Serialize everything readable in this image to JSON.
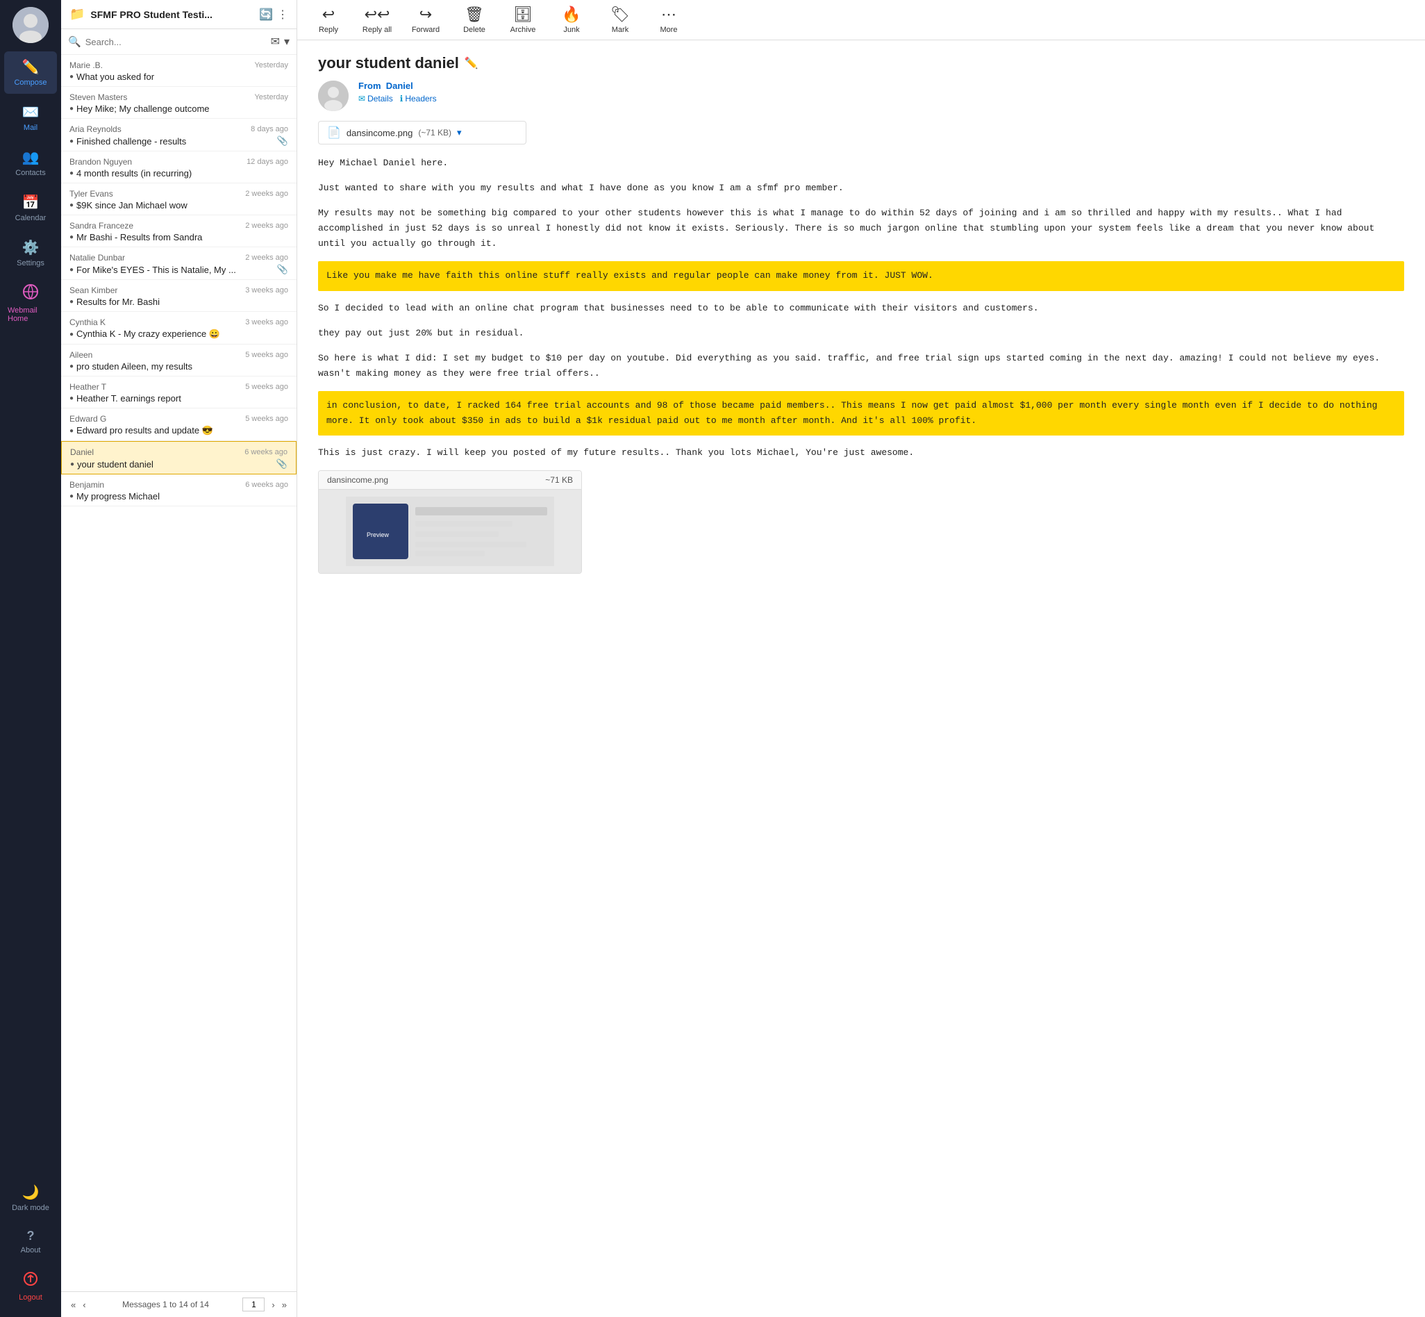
{
  "sidebar": {
    "nav_items": [
      {
        "id": "compose",
        "label": "Compose",
        "icon": "✏️",
        "active": false,
        "class": "compose"
      },
      {
        "id": "mail",
        "label": "Mail",
        "icon": "✉️",
        "active": true
      },
      {
        "id": "contacts",
        "label": "Contacts",
        "icon": "👥",
        "active": false
      },
      {
        "id": "calendar",
        "label": "Calendar",
        "icon": "📅",
        "active": false
      },
      {
        "id": "settings",
        "label": "Settings",
        "icon": "⚙️",
        "active": false
      },
      {
        "id": "webmail",
        "label": "Webmail Home",
        "icon": "🔗",
        "active": false
      }
    ],
    "bottom_items": [
      {
        "id": "dark-mode",
        "label": "Dark mode",
        "icon": "🌙"
      },
      {
        "id": "about",
        "label": "About",
        "icon": "?"
      },
      {
        "id": "logout",
        "label": "Logout",
        "icon": "⏻",
        "class": "logout"
      }
    ]
  },
  "panel": {
    "title": "SFMF PRO Student Testi...",
    "search_placeholder": "Search..."
  },
  "toolbar": {
    "reply_label": "Reply",
    "reply_all_label": "Reply all",
    "forward_label": "Forward",
    "delete_label": "Delete",
    "archive_label": "Archive",
    "junk_label": "Junk",
    "mark_label": "Mark",
    "more_label": "More"
  },
  "emails": [
    {
      "sender": "Marie .B.",
      "date": "Yesterday",
      "subject": "What you asked for",
      "has_attach": false,
      "bullet": true
    },
    {
      "sender": "Steven Masters",
      "date": "Yesterday",
      "subject": "Hey Mike; My challenge outcome",
      "has_attach": false,
      "bullet": true
    },
    {
      "sender": "Aria Reynolds",
      "date": "8 days ago",
      "subject": "Finished challenge - results",
      "has_attach": true,
      "bullet": true
    },
    {
      "sender": "Brandon Nguyen",
      "date": "12 days ago",
      "subject": "4 month results (in recurring)",
      "has_attach": false,
      "bullet": true
    },
    {
      "sender": "Tyler Evans",
      "date": "2 weeks ago",
      "subject": "$9K since Jan Michael wow",
      "has_attach": false,
      "bullet": true
    },
    {
      "sender": "Sandra Franceze",
      "date": "2 weeks ago",
      "subject": "Mr Bashi - Results from Sandra",
      "has_attach": false,
      "bullet": true
    },
    {
      "sender": "Natalie Dunbar",
      "date": "2 weeks ago",
      "subject": "For Mike's EYES - This is Natalie, My ...",
      "has_attach": true,
      "bullet": true
    },
    {
      "sender": "Sean Kimber",
      "date": "3 weeks ago",
      "subject": "Results for Mr. Bashi",
      "has_attach": false,
      "bullet": true
    },
    {
      "sender": "Cynthia K",
      "date": "3 weeks ago",
      "subject": "Cynthia K - My crazy experience 😀",
      "has_attach": false,
      "bullet": true
    },
    {
      "sender": "Aileen",
      "date": "5 weeks ago",
      "subject": "pro studen Aileen, my results",
      "has_attach": false,
      "bullet": true
    },
    {
      "sender": "Heather T",
      "date": "5 weeks ago",
      "subject": "Heather T. earnings report",
      "has_attach": false,
      "bullet": true
    },
    {
      "sender": "Edward G",
      "date": "5 weeks ago",
      "subject": "Edward pro results and update 😎",
      "has_attach": false,
      "bullet": true
    },
    {
      "sender": "Daniel",
      "date": "6 weeks ago",
      "subject": "your student daniel",
      "has_attach": true,
      "bullet": true,
      "selected": true
    },
    {
      "sender": "Benjamin",
      "date": "6 weeks ago",
      "subject": "My progress Michael",
      "has_attach": false,
      "bullet": true
    }
  ],
  "list_footer": {
    "info": "Messages 1 to 14 of 14",
    "page": "1"
  },
  "email_view": {
    "subject": "your student daniel",
    "from_label": "From",
    "from_name": "Daniel",
    "details_label": "Details",
    "headers_label": "Headers",
    "attachment_name": "dansincome.png",
    "attachment_size": "(~71 KB)",
    "body_lines": [
      "Hey Michael Daniel here.",
      "Just wanted to share with you my results and what I have done as you know I am\na sfmf pro member.",
      "My results may not be something big compared to your other students however\nthis is what I manage to do within 52 days of joining and i am so thrilled and\nhappy with my results.. What I had accomplished in just 52 days is so unreal I\nhonestly did not know it exists. Seriously. There is so much jargon online\nthat stumbling upon your system feels like a dream that you never know about\nuntil you actually go through it.",
      "So I decided to lead with an online chat program that businesses need to to be\nable to communicate with their visitors and customers.",
      "they pay out just 20% but in residual.",
      "So here is what I did: I set my budget to $10 per day on youtube. Did\neverything as you said. traffic, and free trial sign ups started coming in the\nnext day. amazing! I could not believe my eyes. wasn't making money as they\nwere free trial offers..",
      "This is just crazy. I will keep you posted of my future results.. Thank you\nlots Michael, You're just awesome."
    ],
    "highlight1": "Like you make me have faith this online stuff really exists and regular people\ncan make money from it. JUST WOW.",
    "highlight2": "in conclusion, to date, I racked 164 free trial accounts and 98 of those\nbecame paid members.. This means I now get paid almost $1,000 per month every\nsingle month even if I decide to do nothing more. It only took about $350 in\nads to build a $1k residual paid out to me month after month. And it's all\n100% profit.",
    "preview_filename": "dansincome.png",
    "preview_size": "~71 KB"
  }
}
